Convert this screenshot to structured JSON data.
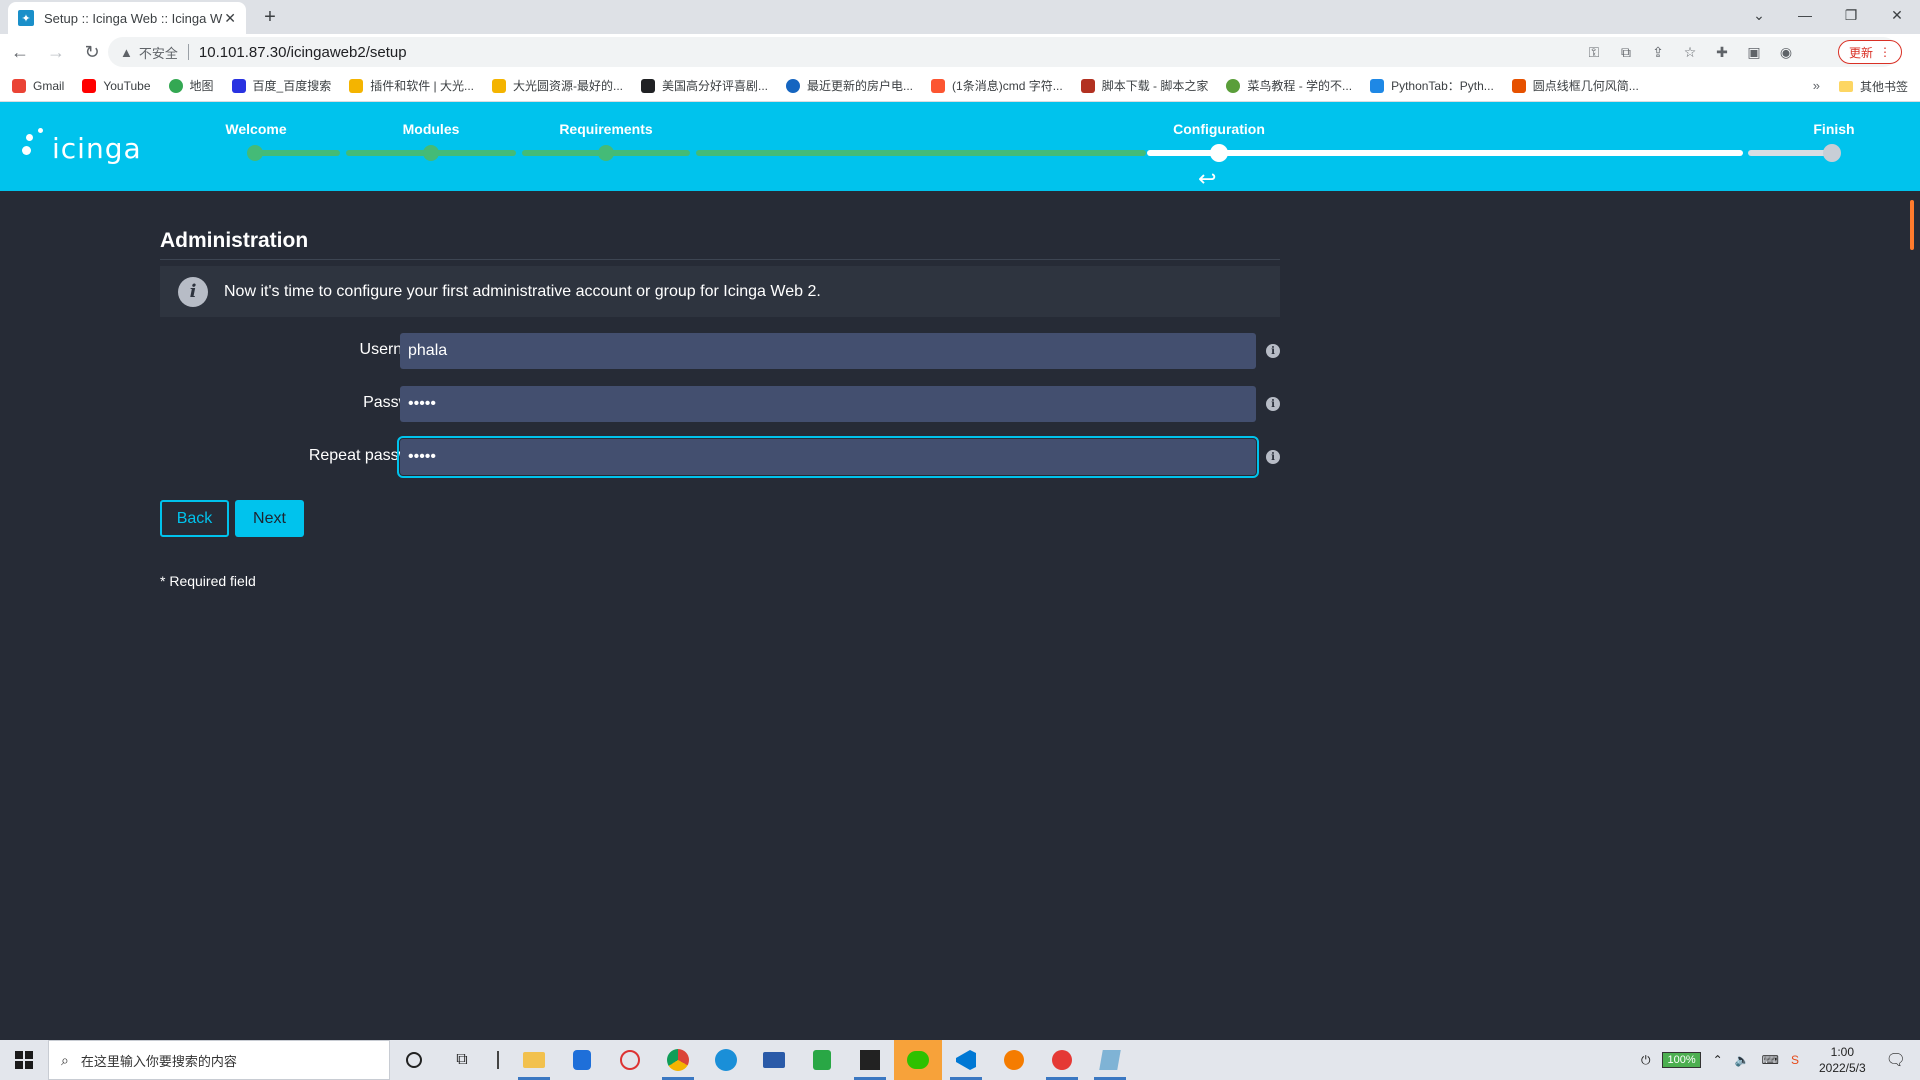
{
  "browser": {
    "tab_title": "Setup :: Icinga Web :: Icinga W",
    "tab_close": "✕",
    "newtab": "+",
    "insecure_label": "不安全",
    "url": "10.101.87.30/icingaweb2/setup",
    "update_label": "更新",
    "bookmarks": [
      "Gmail",
      "YouTube",
      "地图",
      "百度_百度搜索",
      "插件和软件 | 大光...",
      "大光圆资源-最好的...",
      "美国高分好评喜剧...",
      "最近更新的房户电...",
      "(1条消息)cmd 字符...",
      "脚本下载 - 脚本之家",
      "菜鸟教程 - 学的不...",
      "PythonTab：Pyth...",
      "圆点线框几何风简..."
    ],
    "bookmarks_more": "»",
    "other_bookmarks": "其他书签"
  },
  "wizard": {
    "logo_text": "icinga",
    "steps": [
      "Welcome",
      "Modules",
      "Requirements",
      "Configuration",
      "Finish"
    ],
    "current_step": "Configuration"
  },
  "page": {
    "section_title": "Administration",
    "info_icon": "i",
    "info_text": "Now it's time to configure your first administrative account or group for Icinga Web 2.",
    "fields": [
      {
        "label": "Username *",
        "value": "phala"
      },
      {
        "label": "Password *",
        "value": "•••••"
      },
      {
        "label": "Repeat password *",
        "value": "•••••"
      }
    ],
    "help_icon": "i",
    "back_label": "Back",
    "next_label": "Next",
    "required_note": "* Required field"
  },
  "taskbar": {
    "search_placeholder": "在这里输入你要搜索的内容",
    "battery": "100%",
    "time": "1:00",
    "date": "2022/5/3"
  },
  "colors": {
    "accent": "#00c3ed",
    "progress_done": "#44bb77",
    "background": "#262b36",
    "input_bg": "#434f6f"
  }
}
